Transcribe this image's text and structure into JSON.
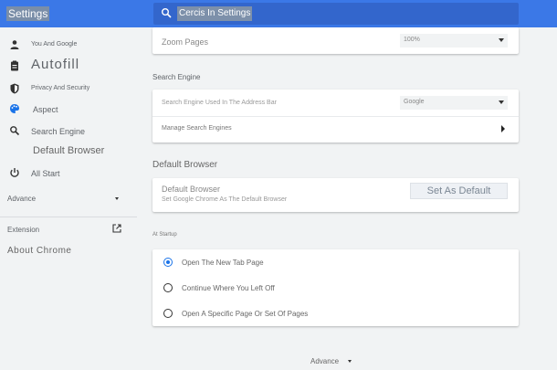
{
  "header": {
    "title": "Settings",
    "search_placeholder": "Cercis In Settings"
  },
  "sidebar": {
    "items": [
      {
        "label": "You And Google",
        "icon": "person-icon"
      },
      {
        "label": "Autofill",
        "icon": "clipboard-icon"
      },
      {
        "label": "Privacy And Security",
        "icon": "shield-icon"
      },
      {
        "label": "Aspect",
        "icon": "palette-icon"
      },
      {
        "label": "Search Engine",
        "icon": "search-icon"
      },
      {
        "label": "Default Browser",
        "icon": "browser-icon"
      },
      {
        "label": "All Start",
        "icon": "power-icon"
      }
    ],
    "advance_label": "Advance",
    "extension_label": "Extension",
    "about_label": "About Chrome"
  },
  "appearance": {
    "zoom_label": "Zoom Pages",
    "zoom_value": "100%"
  },
  "search_engine": {
    "title": "Search Engine",
    "used_label": "Search Engine Used In The Address Bar",
    "engine_value": "Google",
    "manage_label": "Manage Search Engines"
  },
  "default_browser": {
    "title": "Default Browser",
    "row_title": "Default Browser",
    "row_subtitle": "Set Google Chrome As The Default Browser",
    "button_label": "Set As Default"
  },
  "startup": {
    "title": "At Startup",
    "options": [
      {
        "label": "Open The New Tab Page",
        "checked": true
      },
      {
        "label": "Continue Where You Left Off",
        "checked": false
      },
      {
        "label": "Open A Specific Page Or Set Of Pages",
        "checked": false
      }
    ]
  },
  "footer": {
    "advance_label": "Advance"
  },
  "colors": {
    "header_bg": "#3b78e7",
    "accent": "#1a73e8",
    "page_bg": "#f1f3f4"
  }
}
